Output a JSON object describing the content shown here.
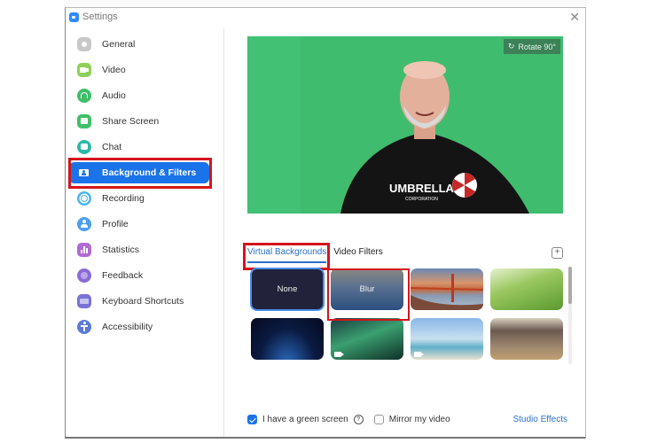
{
  "window": {
    "title": "Settings",
    "close_icon": "close-icon"
  },
  "sidebar": {
    "items": [
      {
        "label": "General",
        "icon": "gear-icon",
        "color": "#c8c8c8"
      },
      {
        "label": "Video",
        "icon": "video-camera-icon",
        "color": "#8fd05a"
      },
      {
        "label": "Audio",
        "icon": "headphones-icon",
        "color": "#3fbf68"
      },
      {
        "label": "Share Screen",
        "icon": "share-screen-icon",
        "color": "#3fbf68"
      },
      {
        "label": "Chat",
        "icon": "chat-bubble-icon",
        "color": "#2eb8a7"
      },
      {
        "label": "Background & Filters",
        "icon": "person-card-icon",
        "color": "#ffffff",
        "active": true
      },
      {
        "label": "Recording",
        "icon": "record-icon",
        "color": "#4ab4ea"
      },
      {
        "label": "Profile",
        "icon": "profile-icon",
        "color": "#4a9ff0"
      },
      {
        "label": "Statistics",
        "icon": "bar-chart-icon",
        "color": "#b06ad4"
      },
      {
        "label": "Feedback",
        "icon": "smiley-icon",
        "color": "#8a6ad4"
      },
      {
        "label": "Keyboard Shortcuts",
        "icon": "keyboard-icon",
        "color": "#7a73d4"
      },
      {
        "label": "Accessibility",
        "icon": "accessibility-icon",
        "color": "#5a7ad4"
      }
    ]
  },
  "preview": {
    "rotate_label": "Rotate 90°",
    "shirt_text": "UMBRELLA",
    "shirt_subtext": "CORPORATION"
  },
  "tabs": [
    {
      "label": "Virtual Backgrounds",
      "active": true
    },
    {
      "label": "Video Filters",
      "active": false
    }
  ],
  "backgrounds": [
    {
      "label": "None",
      "name": "none",
      "selected": true
    },
    {
      "label": "Blur",
      "name": "blur"
    },
    {
      "label": "",
      "name": "golden-gate-bridge"
    },
    {
      "label": "",
      "name": "grass"
    },
    {
      "label": "",
      "name": "earth-from-space"
    },
    {
      "label": "",
      "name": "northern-lights",
      "video": true
    },
    {
      "label": "",
      "name": "beach-palm",
      "video": true
    },
    {
      "label": "",
      "name": "living-room"
    }
  ],
  "footer": {
    "green_screen_label": "I have a green screen",
    "green_screen_checked": true,
    "mirror_label": "Mirror my video",
    "mirror_checked": false,
    "studio_effects_label": "Studio Effects"
  },
  "colors": {
    "accent": "#1a73e8",
    "highlight": "#d4141c",
    "green_screen": "#3dbb6d"
  }
}
